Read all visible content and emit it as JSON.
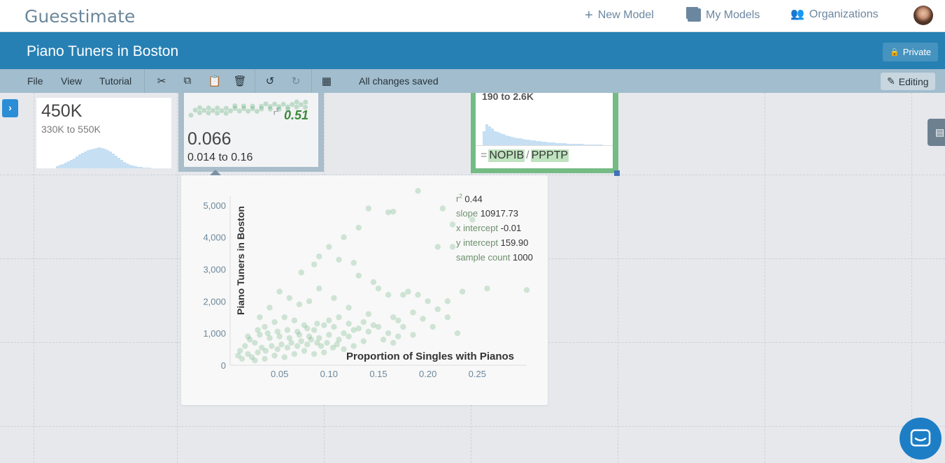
{
  "app": {
    "logo": "Guesstimate"
  },
  "nav": {
    "new_model": "New Model",
    "my_models": "My Models",
    "organizations": "Organizations"
  },
  "model": {
    "title": "Piano Tuners in Boston",
    "privacy_label": "Private"
  },
  "toolbar": {
    "menus": [
      "File",
      "View",
      "Tutorial"
    ],
    "status": "All changes saved",
    "edit_label": "Editing"
  },
  "cards": {
    "population": {
      "value": "450K",
      "range": "330K to 550K"
    },
    "proportion": {
      "value": "0.066",
      "range": "0.014 to 0.16",
      "r2_label": "r2",
      "r2_value": "0.51"
    },
    "tuners": {
      "range": "190 to 2.6K",
      "formula_prefix": "=",
      "formula_tokens": [
        "NOPIB",
        "PPPTP"
      ],
      "formula_op": "/"
    }
  },
  "popup": {
    "stats": [
      {
        "key": "r2",
        "value": "0.44"
      },
      {
        "key": "slope",
        "value": "10917.73"
      },
      {
        "key": "x intercept",
        "value": "-0.01"
      },
      {
        "key": "y intercept",
        "value": "159.90"
      },
      {
        "key": "sample count",
        "value": "1000"
      }
    ]
  },
  "chart_data": {
    "type": "scatter",
    "xlabel": "Proportion of Singles with Pianos",
    "ylabel": "Piano Tuners in Boston",
    "xlim": [
      0,
      0.3
    ],
    "ylim": [
      0,
      5500
    ],
    "xticks": [
      0.05,
      0.1,
      0.15,
      0.2,
      0.25
    ],
    "xtick_labels": [
      "0.05",
      "0.10",
      "0.15",
      "0.20",
      "0.25"
    ],
    "yticks": [
      0,
      1000,
      2000,
      3000,
      4000,
      5000
    ],
    "ytick_labels": [
      "0",
      "1,000",
      "2,000",
      "3,000",
      "4,000",
      "5,000"
    ],
    "point_color": "#3d9d55",
    "points": [
      [
        0.19,
        5450
      ],
      [
        0.14,
        4900
      ],
      [
        0.165,
        4800
      ],
      [
        0.16,
        4780
      ],
      [
        0.215,
        4900
      ],
      [
        0.13,
        4300
      ],
      [
        0.245,
        4550
      ],
      [
        0.225,
        4400
      ],
      [
        0.21,
        3700
      ],
      [
        0.225,
        3700
      ],
      [
        0.115,
        4000
      ],
      [
        0.1,
        3700
      ],
      [
        0.085,
        3150
      ],
      [
        0.072,
        2900
      ],
      [
        0.09,
        3400
      ],
      [
        0.11,
        3300
      ],
      [
        0.125,
        3200
      ],
      [
        0.13,
        2800
      ],
      [
        0.145,
        2600
      ],
      [
        0.15,
        2400
      ],
      [
        0.16,
        2200
      ],
      [
        0.175,
        2200
      ],
      [
        0.18,
        2300
      ],
      [
        0.19,
        2200
      ],
      [
        0.2,
        2000
      ],
      [
        0.22,
        2000
      ],
      [
        0.235,
        2300
      ],
      [
        0.26,
        2400
      ],
      [
        0.3,
        2350
      ],
      [
        0.22,
        1500
      ],
      [
        0.23,
        1000
      ],
      [
        0.17,
        1400
      ],
      [
        0.14,
        1600
      ],
      [
        0.12,
        1800
      ],
      [
        0.105,
        2100
      ],
      [
        0.09,
        2400
      ],
      [
        0.08,
        2000
      ],
      [
        0.07,
        1900
      ],
      [
        0.06,
        2100
      ],
      [
        0.05,
        2300
      ],
      [
        0.04,
        1800
      ],
      [
        0.03,
        1500
      ],
      [
        0.035,
        1200
      ],
      [
        0.045,
        1350
      ],
      [
        0.055,
        1500
      ],
      [
        0.065,
        1400
      ],
      [
        0.075,
        1250
      ],
      [
        0.085,
        1100
      ],
      [
        0.095,
        1250
      ],
      [
        0.1,
        1400
      ],
      [
        0.11,
        1500
      ],
      [
        0.12,
        1300
      ],
      [
        0.13,
        1150
      ],
      [
        0.14,
        1050
      ],
      [
        0.15,
        1200
      ],
      [
        0.16,
        1000
      ],
      [
        0.17,
        900
      ],
      [
        0.155,
        800
      ],
      [
        0.135,
        750
      ],
      [
        0.12,
        900
      ],
      [
        0.11,
        800
      ],
      [
        0.1,
        950
      ],
      [
        0.09,
        850
      ],
      [
        0.08,
        900
      ],
      [
        0.07,
        950
      ],
      [
        0.06,
        850
      ],
      [
        0.05,
        900
      ],
      [
        0.04,
        850
      ],
      [
        0.03,
        950
      ],
      [
        0.025,
        700
      ],
      [
        0.02,
        800
      ],
      [
        0.015,
        600
      ],
      [
        0.01,
        450
      ],
      [
        0.008,
        300
      ],
      [
        0.012,
        200
      ],
      [
        0.018,
        350
      ],
      [
        0.022,
        250
      ],
      [
        0.028,
        400
      ],
      [
        0.032,
        550
      ],
      [
        0.036,
        450
      ],
      [
        0.042,
        600
      ],
      [
        0.048,
        500
      ],
      [
        0.052,
        650
      ],
      [
        0.058,
        550
      ],
      [
        0.062,
        700
      ],
      [
        0.068,
        600
      ],
      [
        0.072,
        750
      ],
      [
        0.078,
        650
      ],
      [
        0.082,
        800
      ],
      [
        0.088,
        700
      ],
      [
        0.092,
        600
      ],
      [
        0.098,
        700
      ],
      [
        0.104,
        550
      ],
      [
        0.108,
        650
      ],
      [
        0.115,
        500
      ],
      [
        0.125,
        600
      ],
      [
        0.045,
        300
      ],
      [
        0.035,
        200
      ],
      [
        0.025,
        150
      ],
      [
        0.055,
        250
      ],
      [
        0.065,
        350
      ],
      [
        0.075,
        450
      ],
      [
        0.085,
        350
      ],
      [
        0.095,
        400
      ],
      [
        0.038,
        1000
      ],
      [
        0.058,
        1100
      ],
      [
        0.068,
        1050
      ],
      [
        0.078,
        1150
      ],
      [
        0.088,
        1300
      ],
      [
        0.048,
        1050
      ],
      [
        0.028,
        1100
      ],
      [
        0.018,
        900
      ],
      [
        0.105,
        1200
      ],
      [
        0.115,
        1000
      ],
      [
        0.125,
        1100
      ],
      [
        0.135,
        1350
      ],
      [
        0.145,
        1250
      ],
      [
        0.165,
        1500
      ],
      [
        0.175,
        1200
      ],
      [
        0.185,
        1650
      ],
      [
        0.195,
        1450
      ],
      [
        0.205,
        1200
      ],
      [
        0.21,
        1750
      ],
      [
        0.185,
        950
      ],
      [
        0.165,
        700
      ]
    ]
  }
}
